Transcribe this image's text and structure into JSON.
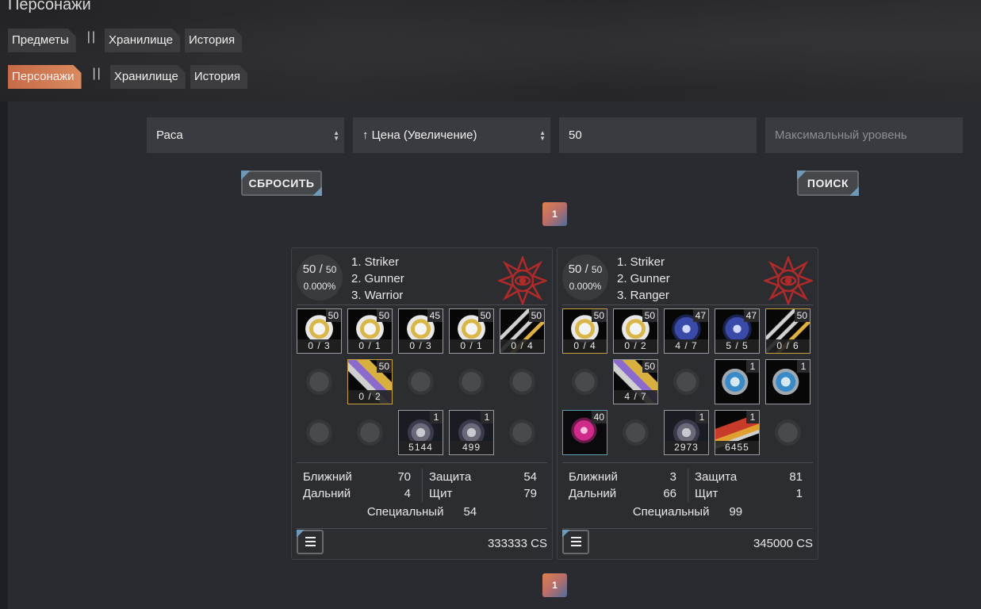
{
  "page": {
    "title": "Персонажи"
  },
  "tabs_row1": [
    {
      "label": "Предметы"
    },
    {
      "sep": "||"
    },
    {
      "label": "Хранилище"
    },
    {
      "label": "История"
    }
  ],
  "tabs_row2": [
    {
      "label": "Персонажи",
      "active": true
    },
    {
      "sep": "||"
    },
    {
      "label": "Хранилище"
    },
    {
      "label": "История"
    }
  ],
  "filters": {
    "race": "Раса",
    "sort": "↑ Цена (Увеличение)",
    "min_level": "50",
    "max_level_placeholder": "Максимальный уровень"
  },
  "buttons": {
    "reset": "СБРОСИТЬ",
    "search": "ПОИСК"
  },
  "pagination": {
    "page": "1"
  },
  "colors": {
    "accent_orange": "#d98a5e",
    "accent_blue": "#6e9ab8",
    "panel": "#2a2b30"
  },
  "cards": [
    {
      "level": "50 /",
      "level_max": "50",
      "exp": "0.000%",
      "classes": [
        "1. Striker",
        "2. Gunner",
        "3. Warrior"
      ],
      "rows": [
        [
          {
            "icon": "white-gold-armor-icon",
            "badge": "50",
            "count": "0 / 3"
          },
          {
            "icon": "white-gold-armor-icon",
            "badge": "50",
            "count": "0 / 1"
          },
          {
            "icon": "white-gold-armor-icon",
            "badge": "45",
            "count": "0 / 3"
          },
          {
            "icon": "white-gold-armor-icon",
            "badge": "50",
            "count": "0 / 1"
          },
          {
            "icon": "claw-weapon-icon",
            "badge": "50",
            "count": "0 / 4"
          }
        ],
        [
          {
            "icon": "empty-cloak-slot-icon",
            "empty": true
          },
          {
            "icon": "drill-weapon-icon",
            "badge": "50",
            "count": "0 / 2",
            "border": "gold"
          },
          {
            "icon": "empty-shirt-slot-icon",
            "empty": true
          },
          {
            "icon": "empty-ring-slot-icon",
            "empty": true
          },
          {
            "icon": "empty-ring-slot-icon",
            "empty": true
          }
        ],
        [
          {
            "icon": "empty-boots-slot-icon",
            "empty": true
          },
          {
            "icon": "empty-boots-slot-icon",
            "empty": true
          },
          {
            "icon": "mech-robot-icon",
            "badge": "1",
            "count": "5144"
          },
          {
            "icon": "mech-robot-icon",
            "badge": "1",
            "count": "499"
          },
          {
            "icon": "empty-glove-slot-icon",
            "empty": true
          }
        ]
      ],
      "stats": {
        "melee_label": "Ближний",
        "melee": "70",
        "ranged_label": "Дальний",
        "ranged": "4",
        "defense_label": "Защита",
        "defense": "54",
        "shield_label": "Щит",
        "shield": "79",
        "special_label": "Специальный",
        "special": "54"
      },
      "price": "333333 CS"
    },
    {
      "level": "50 /",
      "level_max": "50",
      "exp": "0.000%",
      "classes": [
        "1. Striker",
        "2. Gunner",
        "3. Ranger"
      ],
      "rows": [
        [
          {
            "icon": "white-gold-armor-icon",
            "badge": "50",
            "count": "0 / 4",
            "border": "gold"
          },
          {
            "icon": "white-gold-armor-icon",
            "badge": "50",
            "count": "0 / 2"
          },
          {
            "icon": "blue-armor-icon",
            "badge": "47",
            "count": "4 / 7"
          },
          {
            "icon": "blue-armor-icon",
            "badge": "47",
            "count": "5 / 5"
          },
          {
            "icon": "claw-weapon-icon",
            "badge": "50",
            "count": "0 / 6",
            "border": "gold"
          }
        ],
        [
          {
            "icon": "empty-cloak-slot-icon",
            "empty": true
          },
          {
            "icon": "drill-weapon-icon",
            "badge": "50",
            "count": "4 / 7"
          },
          {
            "icon": "empty-shirt-slot-icon",
            "empty": true
          },
          {
            "icon": "crystal-gauntlet-icon",
            "badge": "1"
          },
          {
            "icon": "crystal-gauntlet-icon",
            "badge": "1"
          }
        ],
        [
          {
            "icon": "pink-orb-shop-icon",
            "badge": "40",
            "border": "teal"
          },
          {
            "icon": "empty-boots-slot-icon",
            "empty": true
          },
          {
            "icon": "mech-robot-icon",
            "badge": "1",
            "count": "2973"
          },
          {
            "icon": "red-gold-gun-icon",
            "badge": "1",
            "count": "6455"
          },
          {
            "icon": "empty-glove-slot-icon",
            "empty": true
          }
        ]
      ],
      "stats": {
        "melee_label": "Ближний",
        "melee": "3",
        "ranged_label": "Дальний",
        "ranged": "66",
        "defense_label": "Защита",
        "defense": "81",
        "shield_label": "Щит",
        "shield": "1",
        "special_label": "Специальный",
        "special": "99"
      },
      "price": "345000 CS"
    }
  ]
}
